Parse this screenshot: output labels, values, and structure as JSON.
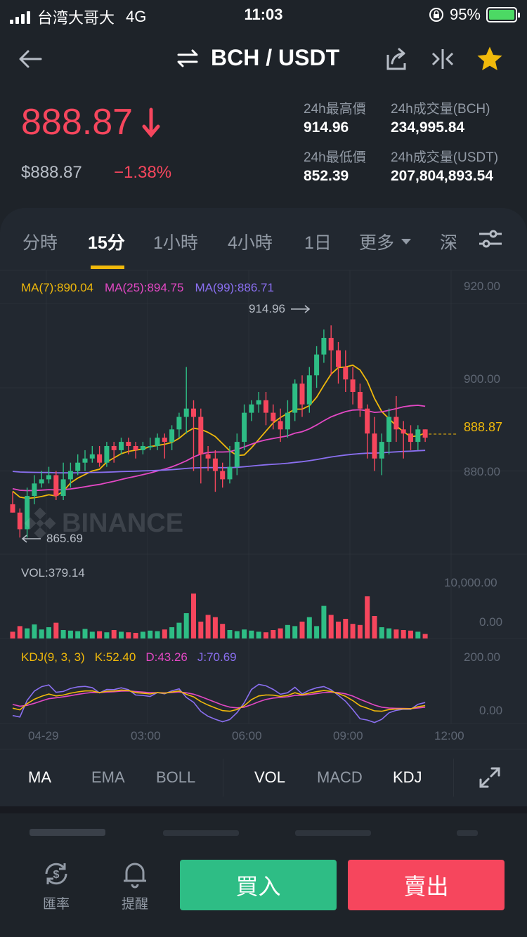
{
  "status_bar": {
    "carrier": "台湾大哥大",
    "network": "4G",
    "time": "11:03",
    "battery": "95%"
  },
  "header": {
    "pair": "BCH / USDT"
  },
  "price": {
    "last": "888.87",
    "usd": "$888.87",
    "change": "−1.38%"
  },
  "stats": {
    "high_label": "24h最高價",
    "high": "914.96",
    "low_label": "24h最低價",
    "low": "852.39",
    "vol_bch_label": "24h成交量(BCH)",
    "vol_bch": "234,995.84",
    "vol_usdt_label": "24h成交量(USDT)",
    "vol_usdt": "207,804,893.54"
  },
  "tabs": [
    "分時",
    "15分",
    "1小時",
    "4小時",
    "1日",
    "更多",
    "深"
  ],
  "active_tab": "15分",
  "ma_legend": {
    "ma7": "MA(7):890.04",
    "ma25": "MA(25):894.75",
    "ma99": "MA(99):886.71"
  },
  "price_axis": [
    "920.00",
    "900.00",
    "880.00"
  ],
  "price_tag": "888.87",
  "high_marker": "914.96",
  "low_marker": "865.69",
  "watermark": "BINANCE",
  "vol": {
    "label": "VOL:379.14",
    "axis": [
      "10,000.00",
      "0.00"
    ]
  },
  "kdj": {
    "label": "KDJ(9, 3, 3)",
    "k": "K:52.40",
    "d": "D:43.26",
    "j": "J:70.69",
    "axis": [
      "200.00",
      "0.00"
    ]
  },
  "time_axis": [
    "04-29",
    "03:00",
    "06:00",
    "09:00",
    "12:00"
  ],
  "indicators": {
    "main": [
      "MA",
      "EMA",
      "BOLL"
    ],
    "sub": [
      "VOL",
      "MACD",
      "KDJ"
    ]
  },
  "bottom": {
    "rate": "匯率",
    "alert": "提醒",
    "buy": "買入",
    "sell": "賣出"
  },
  "colors": {
    "up": "#2ebd85",
    "down": "#f6465d",
    "accent": "#f0b90b",
    "ma7": "#f0b90b",
    "ma25": "#e348c4",
    "ma99": "#8a6ff0"
  },
  "chart_data": {
    "type": "candlestick",
    "candles": [
      [
        872,
        870,
        875,
        870
      ],
      [
        870,
        866,
        871,
        864
      ],
      [
        866,
        874,
        876,
        864
      ],
      [
        874,
        877,
        879,
        872
      ],
      [
        877,
        878,
        880,
        876
      ],
      [
        878,
        879,
        881,
        877
      ],
      [
        879,
        874,
        880,
        873
      ],
      [
        874,
        878,
        882,
        873
      ],
      [
        878,
        880,
        882,
        876
      ],
      [
        880,
        882,
        884,
        879
      ],
      [
        882,
        883,
        885,
        880
      ],
      [
        883,
        884,
        886,
        882
      ],
      [
        884,
        882,
        886,
        881
      ],
      [
        882,
        886,
        887,
        881
      ],
      [
        886,
        885,
        887,
        882
      ],
      [
        885,
        887,
        888,
        884
      ],
      [
        887,
        886,
        888,
        884
      ],
      [
        886,
        885,
        887,
        883
      ],
      [
        885,
        886,
        887,
        884
      ],
      [
        886,
        886,
        888,
        885
      ],
      [
        886,
        888,
        889,
        885
      ],
      [
        888,
        887,
        889,
        883
      ],
      [
        887,
        890,
        891,
        885
      ],
      [
        890,
        893,
        894,
        888
      ],
      [
        893,
        895,
        905,
        889
      ],
      [
        895,
        893,
        897,
        880
      ],
      [
        893,
        884,
        895,
        877
      ],
      [
        884,
        883,
        886,
        880
      ],
      [
        883,
        880,
        885,
        875
      ],
      [
        880,
        878,
        882,
        876
      ],
      [
        878,
        881,
        886,
        877
      ],
      [
        881,
        887,
        889,
        879
      ],
      [
        887,
        894,
        896,
        885
      ],
      [
        894,
        896,
        897,
        892
      ],
      [
        896,
        897,
        899,
        894
      ],
      [
        897,
        894,
        899,
        891
      ],
      [
        894,
        892,
        896,
        890
      ],
      [
        892,
        890,
        895,
        887
      ],
      [
        890,
        894,
        897,
        888
      ],
      [
        894,
        901,
        902,
        892
      ],
      [
        901,
        896,
        903,
        893
      ],
      [
        896,
        903,
        905,
        894
      ],
      [
        903,
        908,
        910,
        900
      ],
      [
        908,
        912,
        914,
        906
      ],
      [
        912,
        909,
        915,
        903
      ],
      [
        909,
        905,
        911,
        901
      ],
      [
        905,
        902,
        909,
        899
      ],
      [
        902,
        899,
        905,
        896
      ],
      [
        899,
        895,
        901,
        893
      ],
      [
        895,
        889,
        896,
        883
      ],
      [
        889,
        883,
        893,
        880
      ],
      [
        883,
        887,
        889,
        879
      ],
      [
        887,
        893,
        895,
        884
      ],
      [
        893,
        890,
        898,
        887
      ],
      [
        890,
        889,
        892,
        883
      ],
      [
        889,
        887,
        891,
        885
      ],
      [
        887,
        890,
        891,
        885
      ],
      [
        890,
        888,
        890,
        887
      ]
    ],
    "ylim": [
      860,
      925
    ],
    "volume": [
      1200,
      2200,
      1800,
      2500,
      1600,
      2000,
      2800,
      1500,
      1400,
      1300,
      1700,
      1200,
      1300,
      1100,
      1500,
      1200,
      1100,
      1000,
      1200,
      1400,
      1300,
      1600,
      2000,
      2800,
      4500,
      8000,
      3000,
      4200,
      3800,
      2600,
      1500,
      1300,
      1600,
      1400,
      1200,
      1100,
      1500,
      1800,
      2400,
      2200,
      3000,
      3800,
      2200,
      5800,
      4200,
      3000,
      3500,
      2600,
      2400,
      7500,
      4000,
      2000,
      1800,
      1600,
      1500,
      1400,
      1200,
      800
    ],
    "vol_ylim": [
      0,
      10000
    ],
    "kdj_ylim": [
      0,
      200
    ]
  }
}
